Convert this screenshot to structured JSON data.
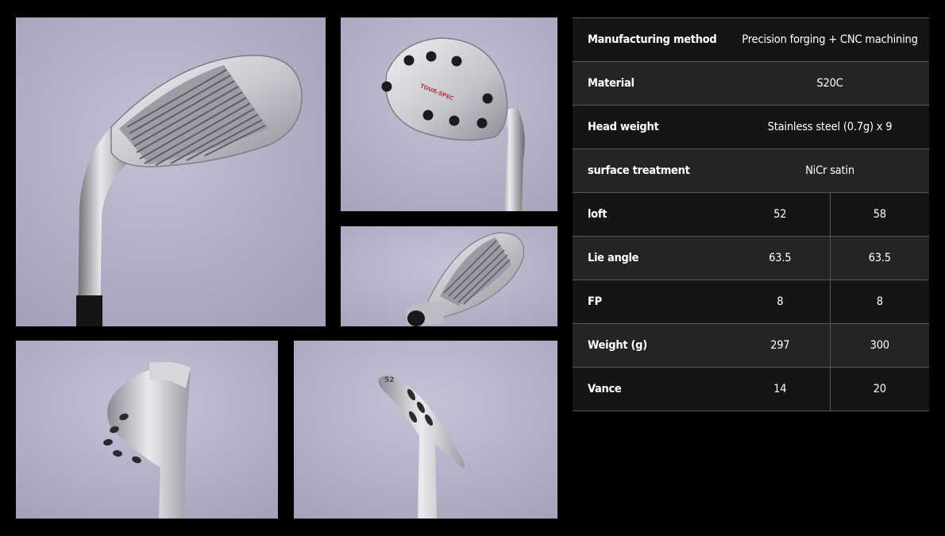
{
  "gallery": {
    "photos": [
      {
        "name": "wedge-face-view"
      },
      {
        "name": "wedge-back-view"
      },
      {
        "name": "wedge-sole-view"
      },
      {
        "name": "wedge-toe-view"
      },
      {
        "name": "wedge-heel-view"
      }
    ],
    "engraving_back": "TOUR-SPEC",
    "engraving_heel": "52"
  },
  "specs": {
    "manufacturing_method": {
      "label": "Manufacturing method",
      "value": "Precision forging + CNC machining"
    },
    "material": {
      "label": "Material",
      "value": "S20C"
    },
    "head_weight": {
      "label": "Head weight",
      "value": "Stainless steel (0.7g) x 9"
    },
    "surface_treatment": {
      "label": "surface treatment",
      "value": "NiCr satin"
    },
    "loft": {
      "label": "loft",
      "values": [
        "52",
        "58"
      ]
    },
    "lie_angle": {
      "label": "Lie angle",
      "values": [
        "63.5",
        "63.5"
      ]
    },
    "fp": {
      "label": "FP",
      "values": [
        "8",
        "8"
      ]
    },
    "weight": {
      "label": "Weight (g)",
      "values": [
        "297",
        "300"
      ]
    },
    "vance": {
      "label": "Vance",
      "values": [
        "14",
        "20"
      ]
    }
  },
  "colors": {
    "background": "#000000",
    "photo_backdrop": "#b2adc4",
    "row_dark": "#151515",
    "row_light": "#242424",
    "divider": "#575757",
    "text": "#ffffff"
  }
}
